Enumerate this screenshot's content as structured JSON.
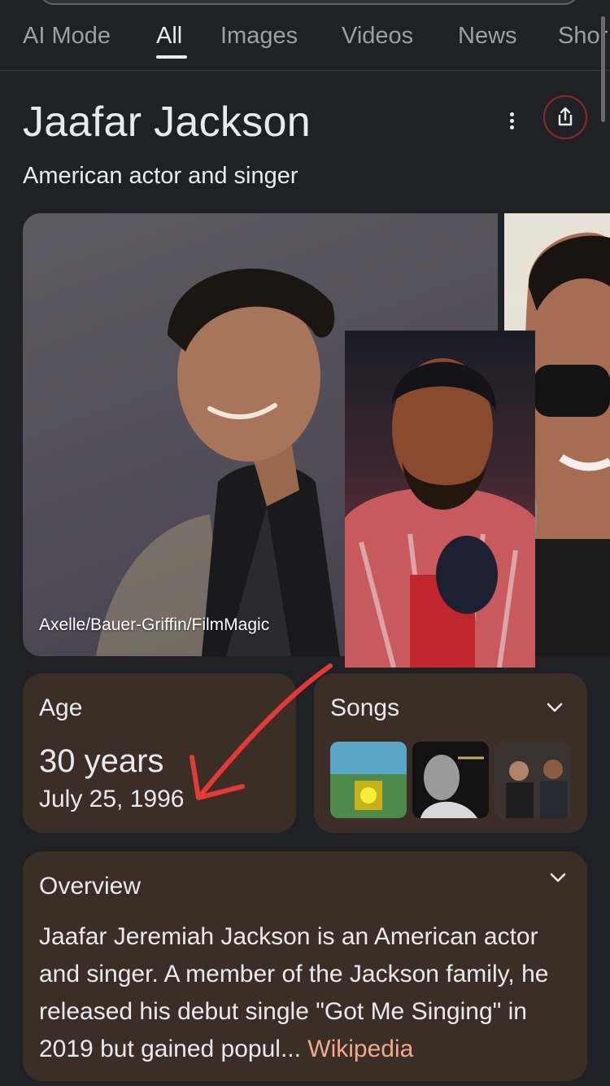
{
  "tabs": [
    {
      "label": "AI Mode"
    },
    {
      "label": "All",
      "active": true
    },
    {
      "label": "Images"
    },
    {
      "label": "Videos"
    },
    {
      "label": "News"
    },
    {
      "label": "Shor"
    }
  ],
  "entity": {
    "title": "Jaafar Jackson",
    "subtitle": "American actor and singer"
  },
  "photos": {
    "credit": "Axelle/Bauer-Griffin/FilmMagic"
  },
  "age_card": {
    "label": "Age",
    "value": "30 years",
    "birth_date": "July 25, 1996"
  },
  "songs_card": {
    "label": "Songs"
  },
  "overview": {
    "label": "Overview",
    "text": "Jaafar Jeremiah Jackson is an American actor and singer. A member of the Jackson family, he released his debut single \"Got Me Singing\" in 2019 but gained popul... ",
    "source_link": "Wikipedia"
  },
  "icons": {
    "more": "more-vert-icon",
    "share": "share-icon",
    "expand": "chevron-down-icon",
    "annotation": "red-arrow-annotation"
  },
  "colors": {
    "background": "#202124",
    "card": "#3b2e26",
    "link": "#f2a98a",
    "annotation_arrow": "#e53935",
    "share_ring": "#8c2b26"
  }
}
